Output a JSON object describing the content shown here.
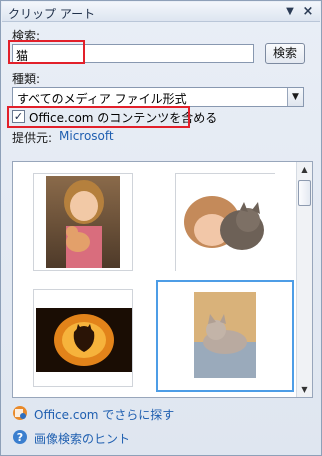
{
  "pane": {
    "title": "クリップ アート",
    "dropdown_glyph": "▼",
    "close_glyph": "×"
  },
  "search": {
    "label": "検索:",
    "value": "猫",
    "button_label": "検索"
  },
  "type": {
    "label": "種類:",
    "selected": "すべてのメディア ファイル形式",
    "arrow_glyph": "▼"
  },
  "include_office": {
    "checked": true,
    "check_glyph": "✓",
    "label": "Office.com のコンテンツを含める"
  },
  "provider": {
    "label": "提供元:",
    "value": "Microsoft"
  },
  "results": {
    "items": [
      {
        "name": "girl-with-kitten",
        "selected": false
      },
      {
        "name": "child-hugging-cat",
        "selected": false
      },
      {
        "name": "pumpkin-cat-carving",
        "selected": false
      },
      {
        "name": "cat-on-pillow",
        "selected": true
      }
    ],
    "scroll_up_glyph": "▲",
    "scroll_down_glyph": "▼"
  },
  "footer": {
    "more_label": "Office.com でさらに探す",
    "tips_label": "画像検索のヒント"
  },
  "colors": {
    "highlight_red": "#e2202a",
    "selection_blue": "#4d9de6",
    "link_blue": "#1f5fb0"
  }
}
